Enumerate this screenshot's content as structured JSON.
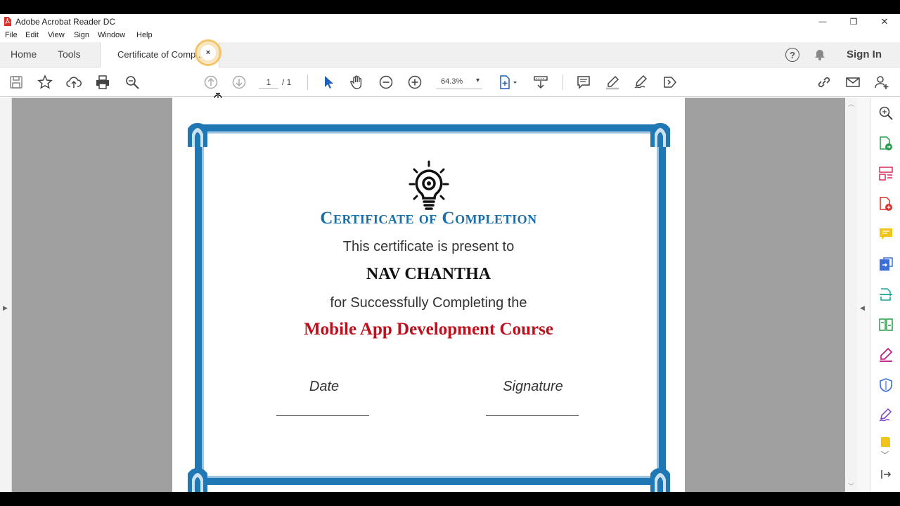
{
  "window": {
    "title": "Adobe Acrobat Reader DC",
    "controls": {
      "minimize": "—",
      "restore": "❐",
      "close": "✕"
    }
  },
  "menu": [
    "File",
    "Edit",
    "View",
    "Sign",
    "Window",
    "Help"
  ],
  "tabs": {
    "home": "Home",
    "tools": "Tools",
    "document": "Certificate of Comp...",
    "close": "×"
  },
  "header_right": {
    "help_icon": "?",
    "sign_in": "Sign In"
  },
  "toolbar": {
    "page_current": "1",
    "page_total": "/ 1",
    "zoom": "64.3%",
    "zoom_chevron": "▾"
  },
  "certificate": {
    "title": "Certificate of Completion",
    "subtitle": "This certificate is present to",
    "recipient": "NAV CHANTHA",
    "completion_text": "for Successfully Completing the",
    "course": "Mobile App Development Course",
    "date_label": "Date",
    "signature_label": "Signature"
  },
  "colors": {
    "border_blue": "#1f78b4",
    "title_blue": "#1a6fa8",
    "course_red": "#c00f1c",
    "canvas_gray": "#a0a0a0",
    "acrobat_red": "#d9302a"
  },
  "icons": {
    "toolbar": [
      "save-icon",
      "bookmark-star-icon",
      "upload-cloud-icon",
      "print-icon",
      "search-zoom-icon",
      "page-up-icon",
      "page-down-icon",
      "select-arrow-icon",
      "hand-icon",
      "zoom-out-icon",
      "zoom-in-icon",
      "fit-page-icon",
      "scroll-mode-icon",
      "comment-icon",
      "highlight-pen-icon",
      "fill-sign-icon",
      "share-tool-icon",
      "link-icon",
      "mail-icon",
      "add-user-icon"
    ],
    "right_panel": [
      "search-zoom-icon",
      "export-pdf-icon",
      "organize-pages-icon",
      "create-pdf-icon",
      "comment-icon",
      "send-for-review-icon",
      "scan-icon",
      "compare-icon",
      "edit-pdf-icon",
      "protect-shield-icon",
      "fill-sign-icon",
      "more-tools-icon"
    ]
  }
}
